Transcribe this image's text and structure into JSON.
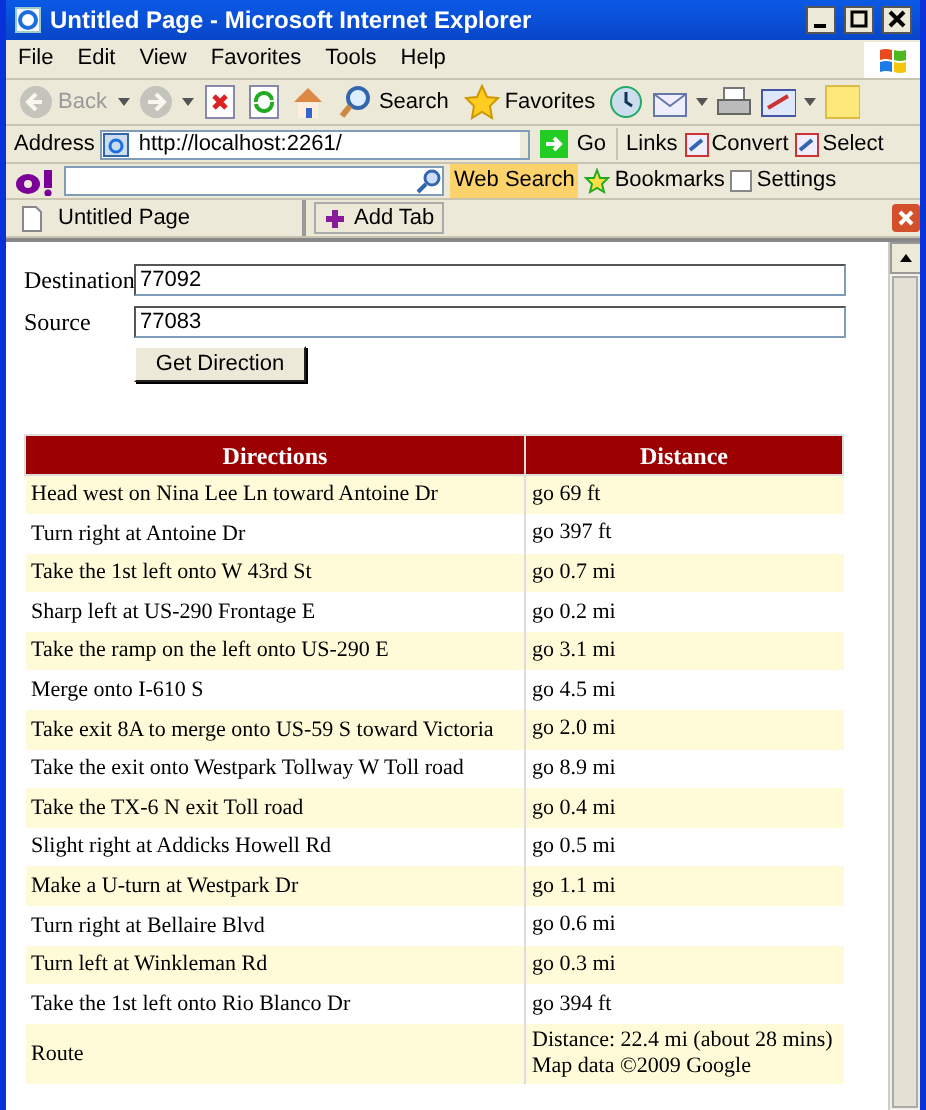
{
  "window": {
    "title": "Untitled Page - Microsoft Internet Explorer"
  },
  "menu": [
    "File",
    "Edit",
    "View",
    "Favorites",
    "Tools",
    "Help"
  ],
  "toolbar": [
    {
      "kind": "back",
      "label": "Back",
      "disabled": true
    },
    {
      "kind": "forward",
      "disabled": true
    },
    {
      "kind": "stop"
    },
    {
      "kind": "refresh"
    },
    {
      "kind": "home"
    },
    {
      "kind": "search",
      "label": "Search"
    },
    {
      "kind": "favorites",
      "label": "Favorites"
    },
    {
      "kind": "history"
    },
    {
      "kind": "mail"
    },
    {
      "kind": "print"
    },
    {
      "kind": "edit"
    },
    {
      "kind": "note"
    }
  ],
  "address_bar": {
    "label": "Address",
    "value": "http://localhost:2261/",
    "go": "Go",
    "links": "Links",
    "extras": [
      "Convert",
      "Select"
    ]
  },
  "search_toolbar": {
    "web_search": "Web Search",
    "bookmarks": "Bookmarks",
    "settings": "Settings"
  },
  "tabs": [
    {
      "label": "Untitled Page",
      "selected": true
    }
  ],
  "add_tab": "Add Tab",
  "form": {
    "fields": [
      {
        "label": "Destination",
        "value": "77092"
      },
      {
        "label": "Source",
        "value": "77083"
      }
    ],
    "button": "Get Direction"
  },
  "table": {
    "columns": [
      "Directions",
      "Distance"
    ],
    "rows": [
      {
        "direction": "Head west on Nina Lee Ln toward Antoine Dr",
        "distance": [
          "go 69 ft"
        ]
      },
      {
        "direction": "Turn right at Antoine Dr",
        "distance": [
          "go 397 ft"
        ]
      },
      {
        "direction": "Take the 1st left onto W 43rd St",
        "distance": [
          "go 0.7 mi"
        ]
      },
      {
        "direction": "Sharp left at US-290 Frontage E",
        "distance": [
          "go 0.2 mi"
        ]
      },
      {
        "direction": "Take the ramp on the left onto US-290 E",
        "distance": [
          "go 3.1 mi"
        ]
      },
      {
        "direction": "Merge onto I-610 S",
        "distance": [
          "go 4.5 mi"
        ]
      },
      {
        "direction": "Take exit 8A to merge onto US-59 S toward Victoria",
        "distance": [
          "go 2.0 mi"
        ]
      },
      {
        "direction": "Take the exit onto Westpark Tollway W Toll road",
        "distance": [
          "go 8.9 mi"
        ]
      },
      {
        "direction": "Take the TX-6 N exit Toll road",
        "distance": [
          "go 0.4 mi"
        ]
      },
      {
        "direction": "Slight right at Addicks Howell Rd",
        "distance": [
          "go 0.5 mi"
        ]
      },
      {
        "direction": "Make a U-turn at Westpark Dr",
        "distance": [
          "go 1.1 mi"
        ]
      },
      {
        "direction": "Turn right at Bellaire Blvd",
        "distance": [
          "go 0.6 mi"
        ]
      },
      {
        "direction": "Turn left at Winkleman Rd",
        "distance": [
          "go 0.3 mi"
        ]
      },
      {
        "direction": "Take the 1st left onto Rio Blanco Dr",
        "distance": [
          "go 394 ft"
        ]
      },
      {
        "direction": "Route",
        "distance": [
          "Distance: 22.4 mi (about 28 mins)",
          "Map data ©2009 Google"
        ]
      }
    ]
  }
}
